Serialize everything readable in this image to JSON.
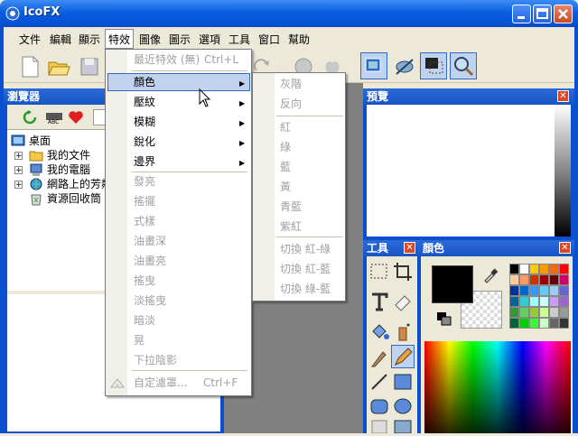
{
  "window": {
    "title": "IcoFX"
  },
  "menubar": [
    "文件",
    "編輯",
    "顯示",
    "特效",
    "圖像",
    "圖示",
    "選項",
    "工具",
    "窗口",
    "幫助"
  ],
  "browser": {
    "title": "瀏覽器",
    "tree": [
      "桌面",
      "我的文件",
      "我的電腦",
      "網路上的芳鄰",
      "資源回收筒"
    ]
  },
  "preview": {
    "title": "預覽"
  },
  "tools": {
    "title": "工具"
  },
  "colors": {
    "title": "顏色"
  },
  "effects_menu": {
    "items": [
      {
        "label": "最近特效 (無)",
        "shortcut": "Ctrl+L",
        "disabled": true
      },
      {
        "label": "顏色",
        "submenu": true,
        "highlighted": true
      },
      {
        "label": "壓紋",
        "submenu": true
      },
      {
        "label": "模糊",
        "submenu": true
      },
      {
        "label": "銳化",
        "submenu": true
      },
      {
        "label": "邊界",
        "submenu": true
      },
      {
        "label": "發亮",
        "disabled": true
      },
      {
        "label": "搖擺",
        "disabled": true
      },
      {
        "label": "式樣",
        "disabled": true
      },
      {
        "label": "油畫深",
        "disabled": true
      },
      {
        "label": "油畫亮",
        "disabled": true
      },
      {
        "label": "搖曳",
        "disabled": true
      },
      {
        "label": "淡搖曳",
        "disabled": true
      },
      {
        "label": "暗淡",
        "disabled": true
      },
      {
        "label": "晃",
        "disabled": true
      },
      {
        "label": "下拉陰影",
        "disabled": true
      },
      {
        "label": "自定濾罩...",
        "shortcut": "Ctrl+F",
        "disabled": true
      }
    ]
  },
  "color_submenu": {
    "items": [
      "灰階",
      "反向",
      "紅",
      "綠",
      "藍",
      "黃",
      "青藍",
      "紫紅",
      "切換 紅-綠",
      "切換 紅-藍",
      "切換 綠-藍"
    ]
  },
  "palette_colors": [
    "#000000",
    "#ffffff",
    "#ffcc00",
    "#ff9900",
    "#ff6600",
    "#ff0000",
    "#ffcc99",
    "#ff9966",
    "#cc3300",
    "#990000",
    "#660000",
    "#cc0066",
    "#003399",
    "#0066cc",
    "#3399ff",
    "#66ccff",
    "#99ccff",
    "#6666cc",
    "#006699",
    "#33cccc",
    "#99ffff",
    "#ccffff",
    "#cc99ff",
    "#9966cc",
    "#339933",
    "#66cc66",
    "#99cc33",
    "#ccff99",
    "#cccccc",
    "#999999",
    "#006633",
    "#00cc00",
    "#33ff33",
    "#ccffcc",
    "#666666",
    "#333333"
  ]
}
